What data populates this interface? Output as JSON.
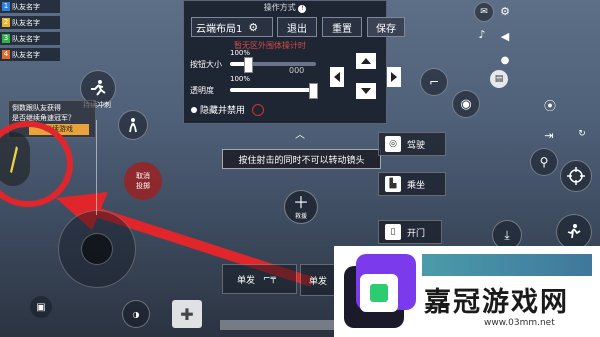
{
  "team": [
    {
      "num": "1",
      "label": "队友名字",
      "color": "#2f7de1"
    },
    {
      "num": "2",
      "label": "队友名字",
      "color": "#e8b32d"
    },
    {
      "num": "3",
      "label": "队友名字",
      "color": "#32b34a"
    },
    {
      "num": "4",
      "label": "队友名字",
      "color": "#e06a2a"
    }
  ],
  "panel": {
    "title": "操作方式",
    "layout_name": "云端布局1",
    "exit": "退出",
    "reset": "重置",
    "save": "保存",
    "hint_overlay": "暂无区外围体操计时",
    "size_label": "按钮大小",
    "size_percent": "100%",
    "size_value": 0.2,
    "opacity_label": "透明度",
    "opacity_percent": "100%",
    "opacity_value": 0.98,
    "hide_disable": "隐藏并禁用"
  },
  "sprint_label": "持续冲刺",
  "auto_msg_1": "倒数跟队友获得",
  "auto_msg_2": "是否继续角速冠军？",
  "auto_btn": "继续游戏",
  "tooltip": "按住射击的同时不可以转动镜头",
  "cancel_aim": [
    "取消",
    "投掷"
  ],
  "rescue": "救援",
  "drive": "驾驶",
  "ride": "乘坐",
  "open_door": "开门",
  "single_fire": "单发",
  "ammo_count": "000",
  "watermark": {
    "brand_cn": "嘉冠游戏网",
    "url": "www.03mm.net"
  },
  "colors": {
    "accent_red": "#e0262b",
    "panel_bg": "#1f2633",
    "brand_teal": "#2a8a9a"
  }
}
